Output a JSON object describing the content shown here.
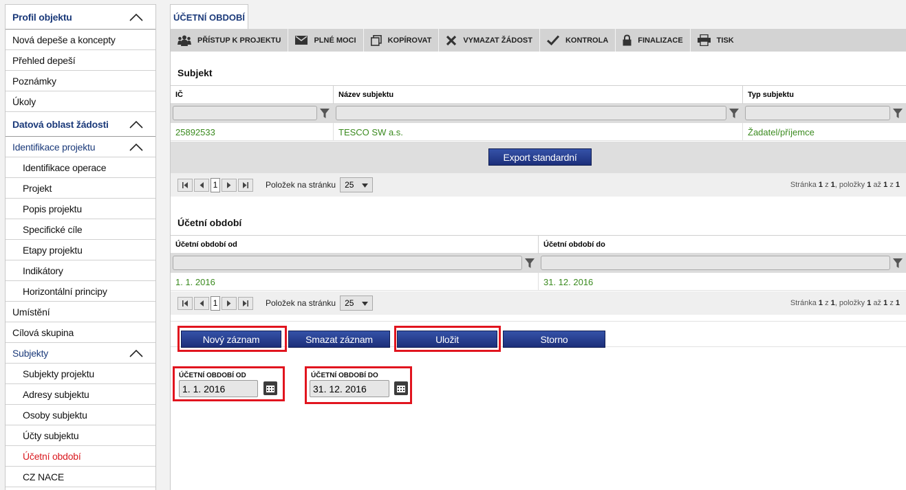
{
  "sidebar": {
    "items": [
      {
        "label": "Profil objektu",
        "type": "head",
        "chevron": true
      },
      {
        "label": "Nová depeše a koncepty",
        "type": "item"
      },
      {
        "label": "Přehled depeší",
        "type": "item"
      },
      {
        "label": "Poznámky",
        "type": "item"
      },
      {
        "label": "Úkoly",
        "type": "item"
      },
      {
        "label": "Datová oblast žádosti",
        "type": "head",
        "chevron": true
      },
      {
        "label": "Identifikace projektu",
        "type": "subhead",
        "chevron": true
      },
      {
        "label": "Identifikace operace",
        "type": "child"
      },
      {
        "label": "Projekt",
        "type": "child"
      },
      {
        "label": "Popis projektu",
        "type": "child"
      },
      {
        "label": "Specifické cíle",
        "type": "child"
      },
      {
        "label": "Etapy projektu",
        "type": "child"
      },
      {
        "label": "Indikátory",
        "type": "child"
      },
      {
        "label": "Horizontální principy",
        "type": "child"
      },
      {
        "label": "Umístění",
        "type": "item"
      },
      {
        "label": "Cílová skupina",
        "type": "item"
      },
      {
        "label": "Subjekty",
        "type": "subhead",
        "chevron": true
      },
      {
        "label": "Subjekty projektu",
        "type": "child"
      },
      {
        "label": "Adresy subjektu",
        "type": "child"
      },
      {
        "label": "Osoby subjektu",
        "type": "child"
      },
      {
        "label": "Účty subjektu",
        "type": "child"
      },
      {
        "label": "Účetní období",
        "type": "child",
        "active": true
      },
      {
        "label": "CZ NACE",
        "type": "child"
      }
    ]
  },
  "tab": {
    "label": "ÚČETNÍ OBDOBÍ"
  },
  "toolbar": {
    "access": "PŘÍSTUP K PROJEKTU",
    "powers": "PLNÉ MOCI",
    "copy": "KOPÍROVAT",
    "delete": "VYMAZAT ŽÁDOST",
    "check": "KONTROLA",
    "finalize": "FINALIZACE",
    "print": "TISK"
  },
  "subjekt": {
    "title": "Subjekt",
    "columns": {
      "ic": "IČ",
      "name": "Název subjektu",
      "type": "Typ subjektu"
    },
    "row": {
      "ic": "25892533",
      "name": "TESCO SW a.s.",
      "type": "Žadatel/příjemce"
    },
    "export_label": "Export standardní",
    "pager": {
      "current": "1",
      "per_page_label": "Položek na stránku",
      "per_page": "25",
      "info_page": "Stránka",
      "info_page_num": "1",
      "info_of": "z",
      "info_pages": "1",
      "info_items": ", položky",
      "info_from": "1",
      "info_to_word": "až",
      "info_to": "1",
      "info_total_word": "z",
      "info_total": "1"
    }
  },
  "obdobi": {
    "title": "Účetní období",
    "columns": {
      "from": "Účetní období od",
      "to": "Účetní období do"
    },
    "row": {
      "from": "1. 1. 2016",
      "to": "31. 12. 2016"
    },
    "pager": {
      "current": "1",
      "per_page_label": "Položek na stránku",
      "per_page": "25",
      "info_page": "Stránka",
      "info_page_num": "1",
      "info_of": "z",
      "info_pages": "1",
      "info_items": ", položky",
      "info_from": "1",
      "info_to_word": "až",
      "info_to": "1",
      "info_total_word": "z",
      "info_total": "1"
    }
  },
  "actions": {
    "new": "Nový záznam",
    "delete": "Smazat záznam",
    "save": "Uložit",
    "cancel": "Storno"
  },
  "form": {
    "from_label": "ÚČETNÍ OBDOBÍ OD",
    "from_value": "1. 1. 2016",
    "to_label": "ÚČETNÍ OBDOBÍ DO",
    "to_value": "31. 12. 2016"
  },
  "colors": {
    "brand": "#1b3a7a",
    "active": "#d9191f",
    "value_green": "#3a8a1e",
    "highlight": "#e1141e"
  }
}
